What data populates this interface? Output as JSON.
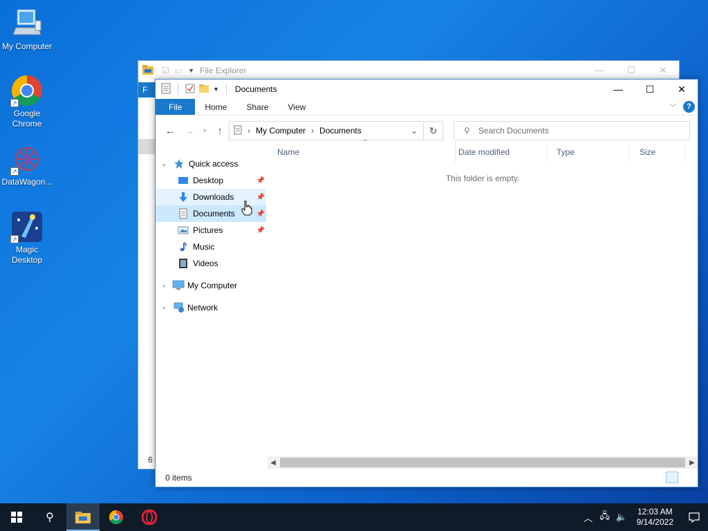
{
  "desktop": {
    "icons": [
      {
        "label": "My Computer",
        "icon": "computer-icon"
      },
      {
        "label": "Google Chrome",
        "icon": "chrome-icon"
      },
      {
        "label": "DataWagon...",
        "icon": "datawagon-icon"
      },
      {
        "label": "Magic Desktop",
        "icon": "magic-desktop-icon"
      }
    ]
  },
  "back_window": {
    "title": "File Explorer",
    "file_tab": "F",
    "status": "6 i"
  },
  "window": {
    "title": "Documents",
    "ribbon": {
      "tabs": [
        "File",
        "Home",
        "Share",
        "View"
      ]
    },
    "address": {
      "crumbs": [
        "My Computer",
        "Documents"
      ]
    },
    "search": {
      "placeholder": "Search Documents"
    },
    "nav": {
      "quick_access": "Quick access",
      "items": [
        {
          "label": "Desktop",
          "icon": "desktop-folder-icon",
          "pinned": true
        },
        {
          "label": "Downloads",
          "icon": "downloads-folder-icon",
          "pinned": true
        },
        {
          "label": "Documents",
          "icon": "documents-folder-icon",
          "pinned": true
        },
        {
          "label": "Pictures",
          "icon": "pictures-folder-icon",
          "pinned": true
        },
        {
          "label": "Music",
          "icon": "music-folder-icon",
          "pinned": false
        },
        {
          "label": "Videos",
          "icon": "videos-folder-icon",
          "pinned": false
        }
      ],
      "my_computer": "My Computer",
      "network": "Network"
    },
    "columns": [
      "Name",
      "Date modified",
      "Type",
      "Size"
    ],
    "empty_message": "This folder is empty.",
    "status": "0 items"
  },
  "taskbar": {
    "time": "12:03 AM",
    "date": "9/14/2022"
  },
  "colors": {
    "accent": "#1979ca",
    "taskbar": "#101b29",
    "selected": "#cce8ff"
  }
}
